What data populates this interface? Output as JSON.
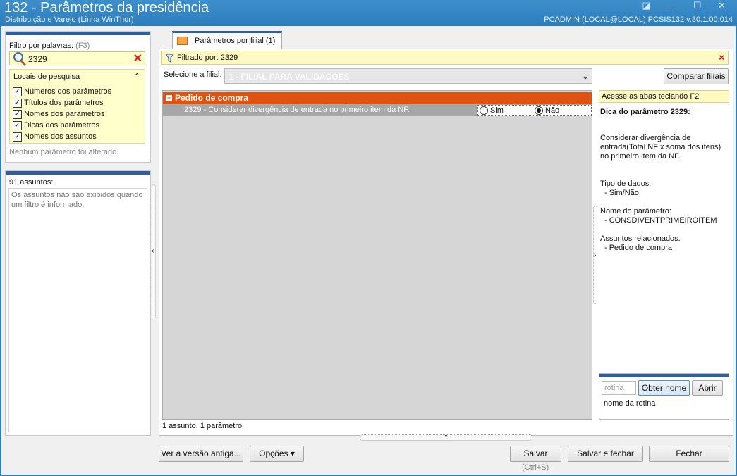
{
  "window": {
    "title": "132 - Parâmetros da presidência",
    "subtitle": "Distribuição e Varejo (Linha WinThor)",
    "user_info": "PCADMIN (LOCAL@LOCAL)   PCSIS132  v.30.1.00.014",
    "controls": "◪ — ☐ ✕"
  },
  "left_panel": {
    "filter_label": "Filtro por palavras:",
    "filter_hint": "(F3)",
    "filter_value": "2329",
    "clear_icon": "✕",
    "search_locations_header": "Locais de pesquisa",
    "collapse_icon": "⌃",
    "checkboxes": [
      {
        "label": "Números dos parâmetros",
        "checked": true
      },
      {
        "label": "Títulos dos parâmetros",
        "checked": true
      },
      {
        "label": "Nomes dos parâmetros",
        "checked": true
      },
      {
        "label": "Dicas dos parâmetros",
        "checked": true
      },
      {
        "label": "Nomes dos assuntos",
        "checked": true
      }
    ],
    "no_changes_text": "Nenhum parâmetro foi alterado.",
    "subjects_count_label": "91 assuntos:",
    "subjects_info": "Os assuntos não são exibidos quando um filtro é informado."
  },
  "tab": {
    "label": "Parâmetros por filial  (1)"
  },
  "filter_bar": {
    "label": "Filtrado por: 2329",
    "close_icon": "×"
  },
  "branch": {
    "label": "Selecione a filial:",
    "value": "1 - FILIAL PARA VALIDACOES",
    "compare_button": "Comparar filiais"
  },
  "grid": {
    "group_title": "Pedido de compra",
    "group_toggle": "−",
    "param_label": "2329 - Considerar divergência de entrada no primeiro item da NF.",
    "option_yes": "Sim",
    "option_no": "Não",
    "selected": "Não"
  },
  "status": "1 assunto, 1 parâmetro",
  "right_panel": {
    "tip_bar": "Acesse as abas teclando F2",
    "tip_title": "Dica do parâmetro 2329:",
    "description": "Considerar divergência de entrada(Total NF x soma dos itens) no primeiro item da NF.",
    "data_type_label": "Tipo de dados:",
    "data_type_value": "- Sim/Não",
    "param_name_label": "Nome do parâmetro:",
    "param_name_value": "- CONSDIVENTPRIMEIROITEM",
    "related_label": "Assuntos relacionados:",
    "related_value": "- Pedido de compra"
  },
  "routine": {
    "placeholder": "rotina",
    "get_name_button": "Obter nome",
    "open_button": "Abrir",
    "name_text": "nome da rotina"
  },
  "footer": {
    "old_version_button": "Ver a versão antiga...",
    "options_button": "Opções ▾",
    "save_button": "Salvar",
    "save_shortcut": "(Ctrl+S)",
    "save_close_button": "Salvar e fechar",
    "close_button": "Fechar"
  }
}
